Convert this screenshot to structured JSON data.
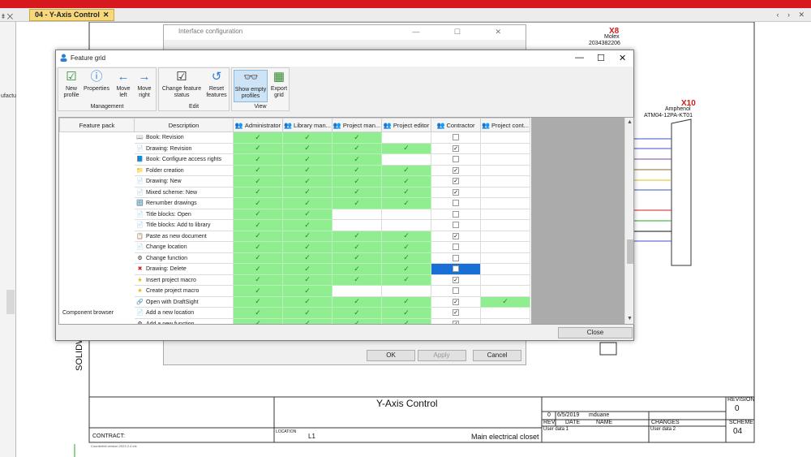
{
  "tabs": {
    "doc_tab": "04 - Y-Axis Control",
    "close_glyph": "✕",
    "left_icons": "⯒ ✕",
    "right_icons": "‹ › ✕"
  },
  "left_pane": {
    "frag1": "ufactu",
    "frag2": ""
  },
  "drawing": {
    "title": "Y-Axis Control",
    "vertical_label": "SOLIDWORKS Electrical",
    "revision_label": "REVISION",
    "revision_value": "0",
    "scheme_label": "SCHEME",
    "scheme_value": "04",
    "rev_row": {
      "rev": "0",
      "date": "6/5/2019",
      "name": "mduane"
    },
    "col_rev": "REV.",
    "col_date": "DATE",
    "col_name": "NAME",
    "col_changes": "CHANGES",
    "user_data_1": "User data 1",
    "user_data_2": "User data 2",
    "contract_label": "CONTRACT:",
    "location_label": "LOCATION",
    "location_value": "L1",
    "location_desc": "Main electrical closet",
    "footer_note": "Counterfeit version 2023 2.4 etc",
    "x8": {
      "tag": "X8",
      "maker": "Molex",
      "part": "2034382206"
    },
    "x10": {
      "tag": "X10",
      "maker": "Amphenol",
      "part": "ATM04-12PA-KT01"
    }
  },
  "iface_dialog": {
    "title": "Interface configuration",
    "ok": "OK",
    "apply": "Apply",
    "cancel": "Cancel",
    "win_btns": "— ☐ ✕"
  },
  "feature_grid": {
    "title": "Feature grid",
    "win_btns": {
      "min": "—",
      "max": "☐",
      "close": "✕"
    },
    "ribbon": {
      "management": {
        "label": "Management",
        "new_profile": "New profile",
        "properties": "Properties"
      },
      "move": {
        "left": "Move left",
        "right": "Move right"
      },
      "edit": {
        "label": "Edit",
        "change_status": "Change feature status",
        "reset": "Reset features"
      },
      "view": {
        "label": "View",
        "show_empty": "Show empty profiles",
        "export": "Export grid"
      }
    },
    "columns": [
      "Feature pack",
      "Description",
      "Administrator",
      "Library man...",
      "Project man...",
      "Project editor",
      "Contractor",
      "Project cont..."
    ],
    "rows": [
      {
        "pack": "",
        "desc": "Book: Revision",
        "icon": "📖",
        "cells": [
          "g",
          "g",
          "g",
          "w",
          "c0",
          "w"
        ]
      },
      {
        "pack": "",
        "desc": "Drawing: Revision",
        "icon": "📄",
        "cells": [
          "g",
          "g",
          "g",
          "g",
          "c1",
          "w"
        ]
      },
      {
        "pack": "",
        "desc": "Book: Configure access rights",
        "icon": "📘",
        "cells": [
          "g",
          "g",
          "g",
          "w",
          "c0",
          "w"
        ]
      },
      {
        "pack": "",
        "desc": "Folder creation",
        "icon": "📁",
        "cells": [
          "g",
          "g",
          "g",
          "g",
          "c1",
          "w"
        ]
      },
      {
        "pack": "",
        "desc": "Drawing: New",
        "icon": "📄",
        "cells": [
          "g",
          "g",
          "g",
          "g",
          "c1",
          "w"
        ]
      },
      {
        "pack": "",
        "desc": "Mixed scheme: New",
        "icon": "📄",
        "cells": [
          "g",
          "g",
          "g",
          "g",
          "c1",
          "w"
        ]
      },
      {
        "pack": "",
        "desc": "Renumber drawings",
        "icon": "🔢",
        "cells": [
          "g",
          "g",
          "g",
          "g",
          "c0",
          "w"
        ]
      },
      {
        "pack": "",
        "desc": "Title blocks: Open",
        "icon": "📄",
        "cells": [
          "g",
          "g",
          "w",
          "w",
          "c0",
          "w"
        ]
      },
      {
        "pack": "",
        "desc": "Title blocks: Add to library",
        "icon": "📄",
        "cells": [
          "g",
          "g",
          "w",
          "w",
          "c0",
          "w"
        ]
      },
      {
        "pack": "",
        "desc": "Paste as new document",
        "icon": "📋",
        "cells": [
          "g",
          "g",
          "g",
          "g",
          "c1",
          "w"
        ]
      },
      {
        "pack": "",
        "desc": "Change location",
        "icon": "📄",
        "cells": [
          "g",
          "g",
          "g",
          "g",
          "c0",
          "w"
        ]
      },
      {
        "pack": "",
        "desc": "Change function",
        "icon": "⚙",
        "cells": [
          "g",
          "g",
          "g",
          "g",
          "c0",
          "w"
        ]
      },
      {
        "pack": "",
        "desc": "Drawing: Delete",
        "icon": "✖",
        "cells": [
          "g",
          "g",
          "g",
          "g",
          "sel",
          "w"
        ]
      },
      {
        "pack": "",
        "desc": "Insert project macro",
        "icon": "★",
        "cells": [
          "g",
          "g",
          "g",
          "g",
          "c1",
          "w"
        ]
      },
      {
        "pack": "",
        "desc": "Create project macro",
        "icon": "★",
        "cells": [
          "g",
          "g",
          "w",
          "w",
          "c0",
          "w"
        ]
      },
      {
        "pack": "",
        "desc": "Open with DraftSight",
        "icon": "🔗",
        "cells": [
          "g",
          "g",
          "g",
          "g",
          "c1",
          "g"
        ]
      },
      {
        "pack": "Component browser",
        "desc": "Add a new location",
        "icon": "📄",
        "cells": [
          "g",
          "g",
          "g",
          "g",
          "c1",
          "w"
        ]
      },
      {
        "pack": "",
        "desc": "Add a new function",
        "icon": "⚙",
        "cells": [
          "g",
          "g",
          "g",
          "g",
          "c1",
          "w"
        ]
      }
    ],
    "check_glyph": "✓",
    "box_check": "✓",
    "close": "Close"
  },
  "colors": {
    "accent_red": "#d8181f",
    "grid_green": "#90ee90",
    "selection_blue": "#1a6fd6",
    "tab_yellow": "#f7d87c"
  }
}
